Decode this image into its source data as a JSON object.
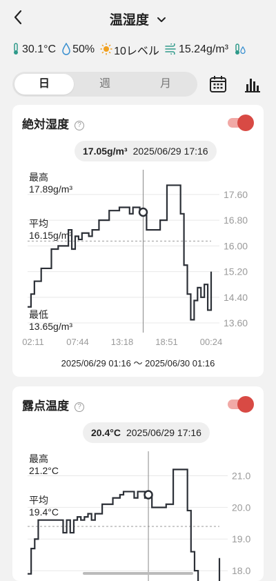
{
  "header": {
    "title": "温湿度",
    "back_icon": "chevron-left-icon",
    "dropdown_icon": "chevron-down-icon"
  },
  "stats": [
    {
      "icon": "thermometer-icon",
      "value": "30.1°C"
    },
    {
      "icon": "droplet-icon",
      "value": "50%"
    },
    {
      "icon": "sun-icon",
      "value": "10レベル"
    },
    {
      "icon": "wind-icon",
      "value": "15.24g/m³"
    },
    {
      "icon": "dew-icon",
      "value": ""
    }
  ],
  "tabs": [
    {
      "label": "日",
      "active": true
    },
    {
      "label": "週",
      "active": false
    },
    {
      "label": "月",
      "active": false
    }
  ],
  "toolbar": {
    "calendar_icon": "calendar-icon",
    "chart_icon": "bar-chart-icon"
  },
  "colors": {
    "toggle_on": "#d84a44",
    "line": "#2b2f36",
    "grid": "#e8e8e8"
  },
  "cards": [
    {
      "title": "絶対湿度",
      "enabled": true,
      "tooltip": {
        "value": "17.05g/m³",
        "time": "2025/06/29 17:16"
      },
      "stats": {
        "max_label": "最高",
        "max_value": "17.89g/m³",
        "avg_label": "平均",
        "avg_value": "16.15g/m³",
        "min_label": "最低",
        "min_value": "13.65g/m³"
      },
      "range_text": "2025/06/29 01:16 ～ 2025/06/30 01:16"
    },
    {
      "title": "露点温度",
      "enabled": true,
      "tooltip": {
        "value": "20.4°C",
        "time": "2025/06/29 17:16"
      },
      "stats": {
        "max_label": "最高",
        "max_value": "21.2°C",
        "avg_label": "平均",
        "avg_value": "19.4°C"
      }
    }
  ],
  "chart_data": [
    {
      "type": "line",
      "title": "絶対湿度",
      "x_tick_labels": [
        "02:11",
        "07:44",
        "13:18",
        "18:51",
        "00:24"
      ],
      "y_tick_labels": [
        "17.60",
        "16.80",
        "16.00",
        "15.20",
        "14.40",
        "13.60"
      ],
      "ylim": [
        13.3,
        18.2
      ],
      "y_ticks": [
        17.6,
        16.8,
        16.0,
        15.2,
        14.4,
        13.6
      ],
      "average": 16.15,
      "cursor_index": 34,
      "series": [
        {
          "values": [
            14.1,
            14.5,
            14.9,
            14.9,
            15.3,
            15.3,
            15.3,
            15.9,
            15.9,
            16.0,
            16.0,
            16.0,
            16.5,
            15.9,
            16.3,
            16.2,
            16.4,
            16.4,
            16.3,
            16.5,
            16.5,
            16.8,
            16.8,
            16.8,
            17.1,
            17.1,
            17.1,
            17.2,
            17.2,
            17.2,
            17.0,
            17.2,
            17.2,
            17.0,
            17.05,
            16.5,
            16.5,
            16.5,
            16.5,
            16.8,
            16.8,
            17.89,
            17.89,
            17.89,
            17.89,
            17.0,
            15.4,
            14.5,
            13.7,
            14.3,
            14.7,
            14.4,
            14.8,
            14.0,
            15.2
          ]
        }
      ]
    },
    {
      "type": "line",
      "title": "露点温度",
      "y_tick_labels": [
        "21.0",
        "20.0",
        "19.0",
        "18.0"
      ],
      "ylim": [
        17.5,
        21.6
      ],
      "y_ticks": [
        21.0,
        20.0,
        19.0,
        18.0
      ],
      "average": 19.4,
      "cursor_index": 34,
      "series": [
        {
          "values": [
            17.9,
            18.7,
            19.0,
            19.6,
            19.6,
            19.6,
            19.6,
            19.6,
            19.6,
            19.6,
            19.2,
            19.6,
            19.2,
            19.6,
            19.7,
            19.6,
            19.7,
            19.8,
            19.6,
            19.8,
            19.8,
            20.1,
            20.1,
            20.1,
            20.3,
            20.3,
            20.4,
            20.5,
            20.5,
            20.5,
            20.3,
            20.5,
            20.5,
            20.3,
            20.4,
            20.0,
            20.0,
            20.0,
            20.0,
            20.1,
            20.1,
            21.2,
            21.2,
            21.2,
            21.2,
            19.9,
            18.6,
            18.0,
            17.5,
            17.5,
            17.5,
            17.5,
            17.5,
            17.5,
            18.4
          ]
        }
      ]
    }
  ]
}
